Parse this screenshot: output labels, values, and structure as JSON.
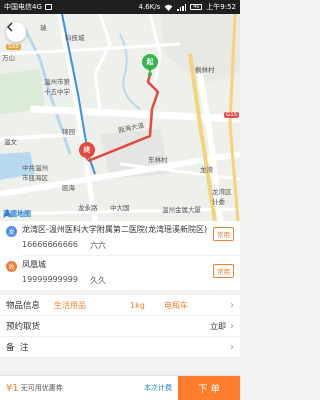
{
  "status_bar": {
    "carrier": "中国电信4G",
    "net_speed": "4.6K/s",
    "battery": "46",
    "time": "上午9:52"
  },
  "map": {
    "labels": {
      "keji": "科技城",
      "shiqi": "温州市第\n十五中学",
      "binhai": "瓯海大道",
      "jinyuan": "锦园",
      "dongling": "东林村",
      "zhonggong": "中共温州\n市瓯海区",
      "ouhai": "瓯海",
      "longwan": "龙湾",
      "longwan_dian": "龙湾区\n计委",
      "fenglin": "枫林村",
      "wanshan": "万山",
      "wenjiaoyuan": "温文",
      "ruiyang": "瑞",
      "longyong": "龙永路",
      "jinhai": "温州金属大厦",
      "zhongda": "中大国"
    },
    "road_badges": {
      "g15": "G15",
      "s33": "S33"
    },
    "start_pin": "起",
    "end_pin": "终",
    "logo": "高德地图"
  },
  "sender": {
    "icon": "发",
    "address": "龙湾区-温州医科大学附属第二医院(龙湾瑶溪新院区)",
    "phone": "16666666666",
    "name": "六六",
    "common_label": "常用"
  },
  "receiver": {
    "icon": "收",
    "address": "凤凰城",
    "phone": "19999999999",
    "name": "久久",
    "common_label": "常用"
  },
  "rows": {
    "goods": {
      "label": "物品信息",
      "category": "生活用品",
      "weight": "1kg",
      "vehicle": "电瓶车"
    },
    "schedule": {
      "label": "预约取货",
      "value": "立即"
    },
    "remark": {
      "label": "备  注",
      "value": ""
    }
  },
  "bottom_bar": {
    "price": "¥1",
    "coupon": "无可用优惠券",
    "detail": "本次计费",
    "order_button": "下 单"
  },
  "colors": {
    "accent": "#ff7d2c",
    "route": "#e5483c",
    "start": "#3bb550",
    "link": "#2a7fd4"
  }
}
